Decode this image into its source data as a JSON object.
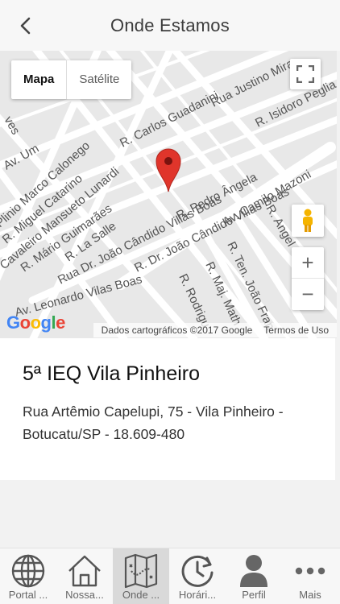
{
  "header": {
    "title": "Onde Estamos",
    "back_icon": "chevron-left-icon"
  },
  "map": {
    "type_options": [
      "Mapa",
      "Satélite"
    ],
    "selected_type": "Mapa",
    "street_labels": [
      "R. Carlos Guadanini",
      "Rua Justino Mira",
      "R. Isidoro Peglia",
      "R. Pedro Ângela",
      "Av. Camilo Mazoni",
      "R. Dr. João Cândido Villas Boas",
      "Rua Dr. João Cândido Villas Boas",
      "R. Mário Guimarães",
      "R. La Salle",
      "Cavaleiro Mansueto Lunardi",
      "R. Miguel Catarino",
      "Plinio Marco Calonego",
      "Av. Leonardo Vilas Boas",
      "R. Ten. João Fran",
      "R. Maj. Math",
      "R. Rodrigu",
      "R. Angel",
      "Av. Um",
      "ves"
    ],
    "logo_text": "Google",
    "copyright": "Dados cartográficos ©2017 Google",
    "terms": "Termos de Uso",
    "zoom_in": "+",
    "zoom_out": "−"
  },
  "place": {
    "name": "5ª IEQ Vila Pinheiro",
    "address": "Rua Artêmio Capelupi, 75 - Vila Pinheiro - Botucatu/SP - 18.609-480"
  },
  "tabs": [
    {
      "label": "Portal ...",
      "icon": "globe-icon"
    },
    {
      "label": "Nossa...",
      "icon": "home-icon"
    },
    {
      "label": "Onde ...",
      "icon": "map-icon"
    },
    {
      "label": "Horári...",
      "icon": "clock-icon"
    },
    {
      "label": "Perfil",
      "icon": "person-icon"
    },
    {
      "label": "Mais",
      "icon": "more-icon"
    }
  ],
  "active_tab": "Onde ...",
  "colors": {
    "marker": "#e0352b",
    "header_bg": "#f7f7f7",
    "active_tab_bg": "#d9d9d9"
  }
}
